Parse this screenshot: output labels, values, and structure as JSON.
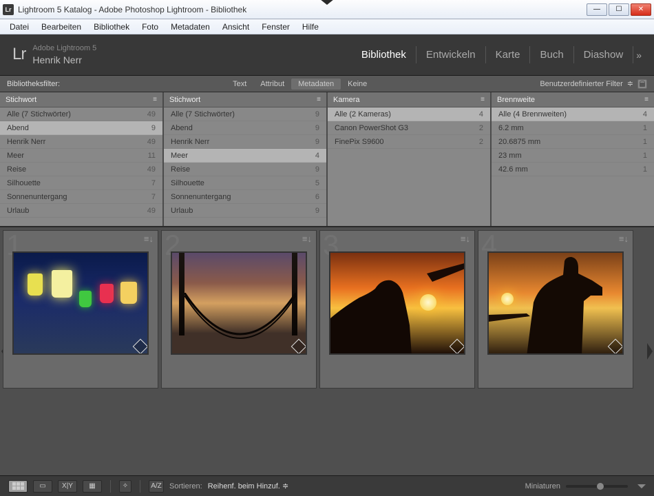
{
  "window": {
    "title": "Lightroom 5 Katalog - Adobe Photoshop Lightroom - Bibliothek"
  },
  "menubar": [
    "Datei",
    "Bearbeiten",
    "Bibliothek",
    "Foto",
    "Metadaten",
    "Ansicht",
    "Fenster",
    "Hilfe"
  ],
  "header": {
    "logo": "Lr",
    "product": "Adobe Lightroom 5",
    "user": "Henrik Nerr",
    "modules": [
      "Bibliothek",
      "Entwickeln",
      "Karte",
      "Buch",
      "Diashow"
    ],
    "active_module": "Bibliothek",
    "more": "»"
  },
  "filterbar": {
    "label": "Bibliotheksfilter:",
    "tabs": [
      "Text",
      "Attribut",
      "Metadaten",
      "Keine"
    ],
    "active_tab": "Metadaten",
    "custom_filter": "Benutzerdefinierter Filter",
    "custom_arrow": "≑"
  },
  "columns": [
    {
      "header": "Stichwort",
      "selected": 1,
      "rows": [
        {
          "label": "Alle (7 Stichwörter)",
          "count": "49"
        },
        {
          "label": "Abend",
          "count": "9"
        },
        {
          "label": "Henrik Nerr",
          "count": "49"
        },
        {
          "label": "Meer",
          "count": "11"
        },
        {
          "label": "Reise",
          "count": "49"
        },
        {
          "label": "Silhouette",
          "count": "7"
        },
        {
          "label": "Sonnenuntergang",
          "count": "7"
        },
        {
          "label": "Urlaub",
          "count": "49"
        }
      ]
    },
    {
      "header": "Stichwort",
      "selected": 3,
      "rows": [
        {
          "label": "Alle (7 Stichwörter)",
          "count": "9"
        },
        {
          "label": "Abend",
          "count": "9"
        },
        {
          "label": "Henrik Nerr",
          "count": "9"
        },
        {
          "label": "Meer",
          "count": "4"
        },
        {
          "label": "Reise",
          "count": "9"
        },
        {
          "label": "Silhouette",
          "count": "5"
        },
        {
          "label": "Sonnenuntergang",
          "count": "6"
        },
        {
          "label": "Urlaub",
          "count": "9"
        }
      ]
    },
    {
      "header": "Kamera",
      "selected": 0,
      "rows": [
        {
          "label": "Alle (2 Kameras)",
          "count": "4"
        },
        {
          "label": "Canon PowerShot G3",
          "count": "2"
        },
        {
          "label": "FinePix S9600",
          "count": "2"
        }
      ]
    },
    {
      "header": "Brennweite",
      "selected": 0,
      "rows": [
        {
          "label": "Alle (4 Brennweiten)",
          "count": "4"
        },
        {
          "label": "6.2 mm",
          "count": "1"
        },
        {
          "label": "20.6875 mm",
          "count": "1"
        },
        {
          "label": "23 mm",
          "count": "1"
        },
        {
          "label": "42.6 mm",
          "count": "1"
        }
      ]
    }
  ],
  "grid": {
    "cells": [
      "1",
      "2",
      "3",
      "4"
    ],
    "badge": "≡↓"
  },
  "toolbar": {
    "sort_label": "Sortieren:",
    "sort_value": "Reihenf. beim Hinzuf.",
    "sort_arrow": "≑",
    "thumbs_label": "Miniaturen",
    "az": "A/Z"
  }
}
